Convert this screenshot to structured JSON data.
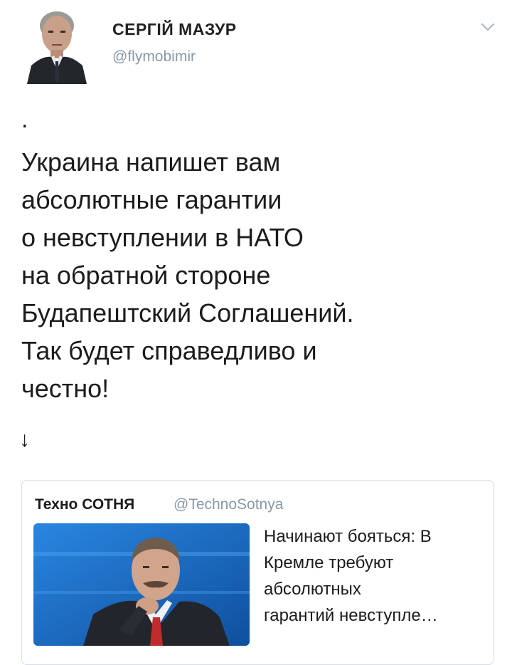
{
  "author": {
    "name": "СЕРГІЙ МАЗУР",
    "handle": "@flymobimir",
    "avatar_icon": "profile-photo"
  },
  "menu_icon": "chevron-down-icon",
  "tweet": {
    "lead_mark": ".",
    "lines": [
      "Украина напишет вам",
      "абсолютные гарантии",
      "о невступлении в НАТО",
      "на обратной стороне",
      "Будапештский Соглашений.",
      "Так будет справедливо и",
      "честно!"
    ],
    "arrow": "↓"
  },
  "quoted": {
    "name": "Техно СОТНЯ",
    "handle": "@TechnoSotnya",
    "text_lines": [
      "Начинают бояться: В",
      "Кремле требуют",
      "абсолютных",
      "гарантий невступле…"
    ],
    "image_icon": "article-photo"
  },
  "colors": {
    "text": "#14171a",
    "muted": "#8899a6",
    "border": "#d6dde2",
    "photo_bg": "#1e6ec8"
  }
}
